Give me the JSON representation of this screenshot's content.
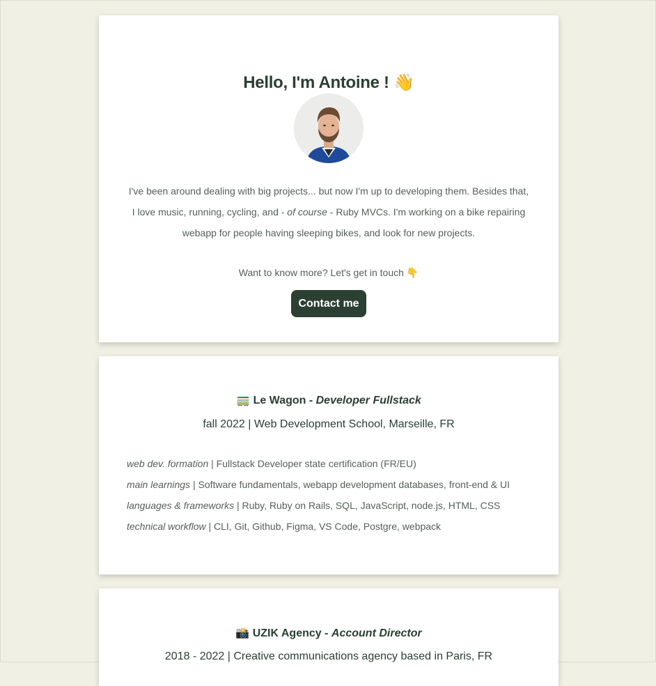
{
  "intro": {
    "title": "Hello, I'm Antoine !",
    "title_emoji": "👋",
    "bio_part1": "I've been around dealing with big projects... but now I'm up to developing them. Besides that, I love music, running, cycling, and - ",
    "bio_italic": "of course",
    "bio_part2": " - Ruby MVCs. I'm working on a bike repairing webapp for people having sleeping bikes, and look for new projects.",
    "cta_text": "Want to know more? Let's get in touch",
    "cta_emoji": "👇",
    "contact_label": "Contact me"
  },
  "experiences": [
    {
      "emoji": "🚃",
      "company": "Le Wagon",
      "separator": " - ",
      "role": "Developer Fullstack",
      "subtitle": "fall 2022 | Web Development School, Marseille, FR",
      "details": [
        {
          "label": "web dev. formation",
          "value": " | Fullstack Developer state certification (FR/EU)"
        },
        {
          "label": "main learnings",
          "value": " | Software fundamentals, webapp development databases, front-end & UI"
        },
        {
          "label": "languages & frameworks",
          "value": " | Ruby, Ruby on Rails, SQL, JavaScript, node.js, HTML, CSS"
        },
        {
          "label": "technical workflow",
          "value": " | CLI, Git, Github, Figma, VS Code, Postgre, webpack"
        }
      ]
    },
    {
      "emoji": "📸",
      "company": "UZIK Agency",
      "separator": " - ",
      "role": "Account Director",
      "subtitle": "2018 - 2022 | Creative communications agency based in Paris, FR"
    }
  ],
  "colors": {
    "background": "#f0f0e4",
    "card": "#ffffff",
    "accent": "#2b4033",
    "text": "#2b3f33",
    "muted_text": "#555f58"
  }
}
